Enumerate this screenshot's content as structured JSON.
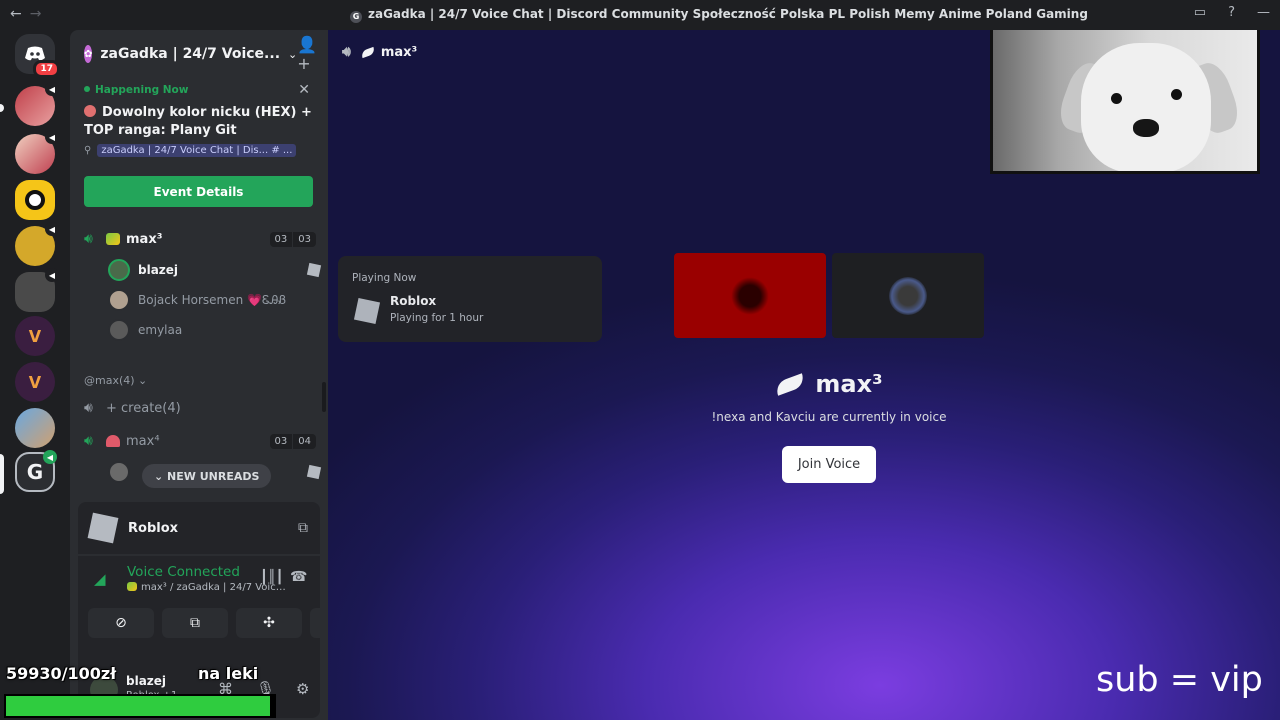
{
  "window": {
    "title": "zaGadka | 24/7 Voice Chat | Discord Community Społeczność Polska PL Polish Memy Anime Poland Gaming",
    "back": "←",
    "forward": "→"
  },
  "rail": {
    "dm_badge": "17"
  },
  "server": {
    "name": "zaGadka | 24/7 Voice...",
    "chevron": "⌄"
  },
  "event": {
    "status": "Happening Now",
    "title": "Dowolny kolor nicku (HEX) + TOP ranga: Plany Git",
    "location": "zaGadka | 24/7 Voice Chat | Dis... # ...",
    "button": "Event Details"
  },
  "channels": [
    {
      "name": "max³",
      "count_a": "03",
      "count_b": "03"
    },
    {
      "name": "+ create(4)"
    },
    {
      "name": "max⁴",
      "count_a": "03",
      "count_b": "04"
    }
  ],
  "members": [
    {
      "name": "blazej"
    },
    {
      "name": "Bojack Horsemen 💗ᏋᎯᏰ"
    },
    {
      "name": "emylaa"
    }
  ],
  "category": "@max(4) ⌄",
  "new_unreads": "⌄ NEW UNREADS",
  "activity": {
    "game": "Roblox"
  },
  "voice": {
    "status": "Voice Connected",
    "channel": "max³ / zaGadka | 24/7 Voice C..."
  },
  "user": {
    "name": "blazej",
    "status": "Roblox +1"
  },
  "stage": {
    "channel": "max³",
    "playing_header": "Playing Now",
    "playing_game": "Roblox",
    "playing_time": "Playing for 1 hour",
    "center_name": "max³",
    "center_desc": "!nexa and Kavciu are currently in voice",
    "join_button": "Join Voice"
  },
  "overlay": {
    "donations": "59930/100zł",
    "goal": "na leki",
    "progress": 0.985,
    "sub_text": "sub = vip",
    "bar_color": "#2fcc3f"
  }
}
